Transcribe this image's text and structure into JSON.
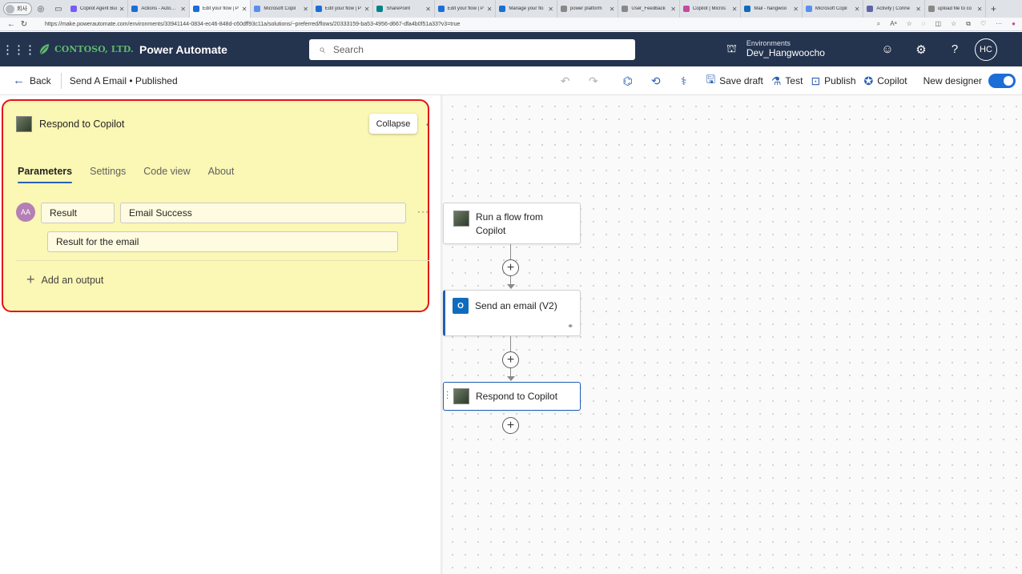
{
  "browser": {
    "profile_label": "회사",
    "tabs": [
      {
        "title": "Copilot Agent Bui",
        "color": "#7a5af5",
        "active": false
      },
      {
        "title": "Actions - Auto…",
        "color": "#1d6dd6",
        "active": false
      },
      {
        "title": "Edit your flow | P",
        "color": "#1d6dd6",
        "active": true
      },
      {
        "title": "Microsoft Copil",
        "color": "#5b8def",
        "active": false
      },
      {
        "title": "Edit your flow | P",
        "color": "#1d6dd6",
        "active": false
      },
      {
        "title": "SharePoint",
        "color": "#038387",
        "active": false
      },
      {
        "title": "Edit your flow | P",
        "color": "#1d6dd6",
        "active": false
      },
      {
        "title": "Manage your flo",
        "color": "#1d6dd6",
        "active": false
      },
      {
        "title": "power platform",
        "color": "#888888",
        "active": false
      },
      {
        "title": "User_Feedback",
        "color": "#888888",
        "active": false
      },
      {
        "title": "Copilot | Micros",
        "color": "#c44b9e",
        "active": false
      },
      {
        "title": "Mail - hangwoo",
        "color": "#0f6cbd",
        "active": false
      },
      {
        "title": "Microsoft Copil",
        "color": "#5b8def",
        "active": false
      },
      {
        "title": "Activity | Conne",
        "color": "#6264a7",
        "active": false
      },
      {
        "title": "upload file to co",
        "color": "#888888",
        "active": false
      }
    ],
    "url": "https://make.powerautomate.com/environments/33941144-0834-ec46-848d-c60dff93c11a/solutions/~preferred/flows/20333159-ba53-4956-d667-dfa4b0f51a33?v3=true"
  },
  "header": {
    "logo_text": "CONTOSO, LTD.",
    "brand": "Power Automate",
    "search_placeholder": "Search",
    "env_label": "Environments",
    "env_value": "Dev_Hangwoocho",
    "avatar_initials": "HC"
  },
  "cmdbar": {
    "back_label": "Back",
    "flow_title": "Send A Email • Published",
    "save_draft": "Save draft",
    "test": "Test",
    "publish": "Publish",
    "copilot": "Copilot",
    "new_designer": "New designer",
    "new_designer_on": true
  },
  "panel": {
    "title": "Respond to Copilot",
    "collapse_label": "Collapse",
    "tabs": [
      "Parameters",
      "Settings",
      "Code view",
      "About"
    ],
    "selected_tab": "Parameters",
    "output": {
      "type_badge": "AA",
      "name": "Result",
      "value": "Email Success",
      "description": "Result for the email"
    },
    "add_output_label": "Add an output"
  },
  "canvas": {
    "nodes": [
      {
        "label": "Run a flow from Copilot"
      },
      {
        "label": "Send an email (V2)",
        "icon_letter": "O"
      },
      {
        "label": "Respond to Copilot"
      }
    ]
  }
}
